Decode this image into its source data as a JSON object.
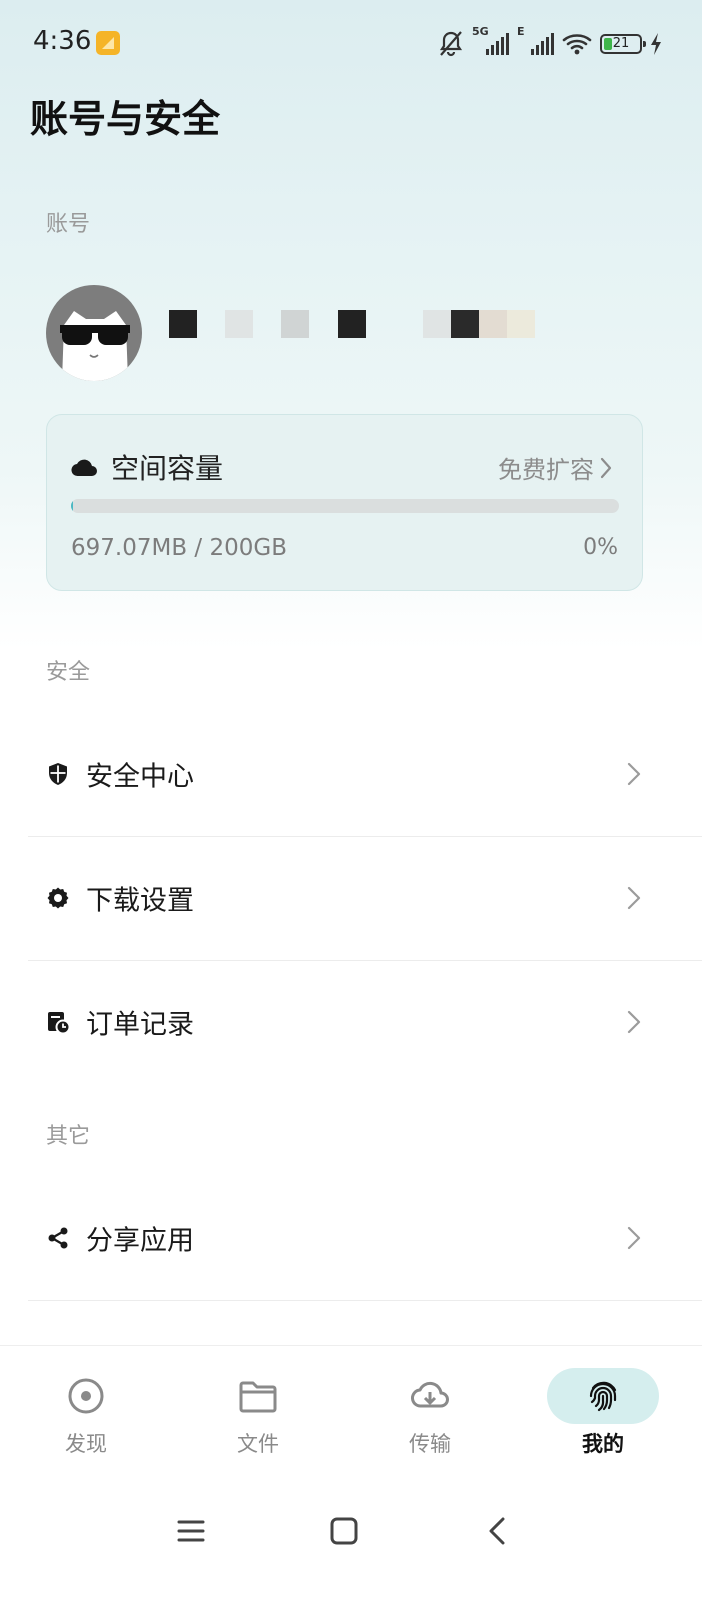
{
  "status_bar": {
    "time": "4:36",
    "network_tag_1": "5G",
    "network_tag_2": "E",
    "battery_level": "21",
    "battery_fraction": 0.21
  },
  "page": {
    "title": "账号与安全"
  },
  "account": {
    "section_label": "账号",
    "masked_username_blocks": [
      "#222222",
      "#e0e4e4",
      "#d0d4d4",
      "#222222",
      "#e0e4e4",
      "#2a2a2a",
      "#e3dcd2",
      "#eceadc"
    ]
  },
  "storage": {
    "title": "空间容量",
    "expand_label": "免费扩容",
    "usage_text": "697.07MB / 200GB",
    "percent_text": "0%",
    "used_fraction": 0.0034
  },
  "security": {
    "section_label": "安全",
    "items": [
      {
        "label": "安全中心",
        "icon": "shield-icon"
      },
      {
        "label": "下载设置",
        "icon": "gear-icon"
      },
      {
        "label": "订单记录",
        "icon": "order-history-icon"
      }
    ]
  },
  "other": {
    "section_label": "其它",
    "items": [
      {
        "label": "分享应用",
        "icon": "share-icon"
      }
    ]
  },
  "bottom_nav": {
    "items": [
      {
        "label": "发现",
        "icon": "discover-icon"
      },
      {
        "label": "文件",
        "icon": "folder-icon"
      },
      {
        "label": "传输",
        "icon": "cloud-download-icon"
      },
      {
        "label": "我的",
        "icon": "fingerprint-icon",
        "active": true
      }
    ]
  },
  "colors": {
    "accent": "#4bb8c2",
    "active_pill": "#d5eeee",
    "card_bg": "#e6f2f2"
  }
}
